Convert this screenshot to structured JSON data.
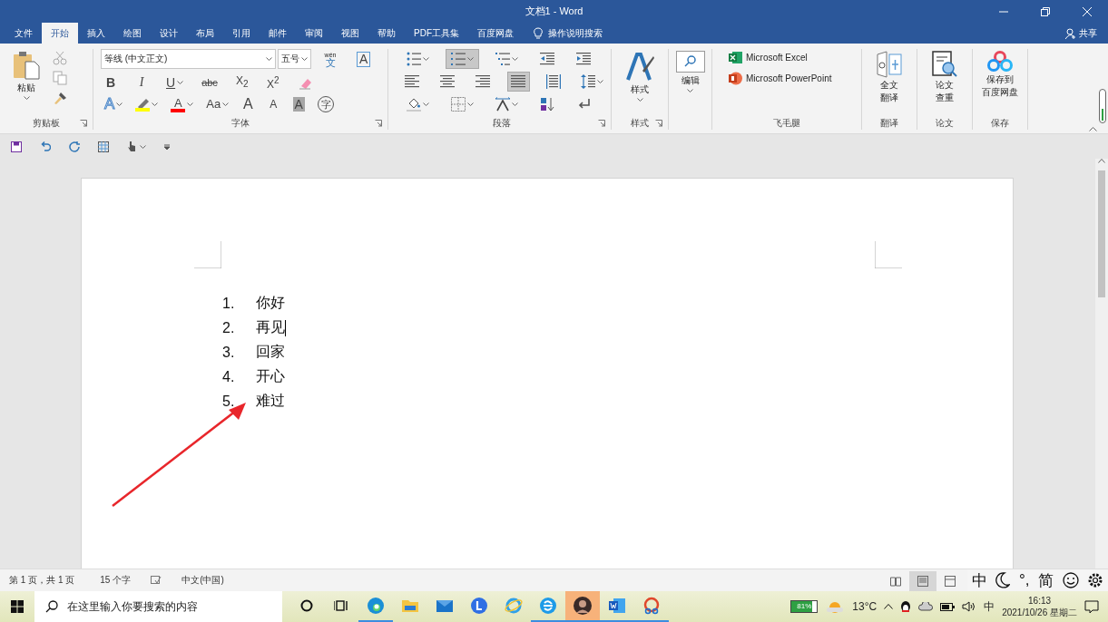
{
  "window": {
    "title": "文档1  -  Word"
  },
  "tabs": [
    {
      "label": "文件",
      "selected": false
    },
    {
      "label": "开始",
      "selected": true
    },
    {
      "label": "插入",
      "selected": false
    },
    {
      "label": "绘图",
      "selected": false
    },
    {
      "label": "设计",
      "selected": false
    },
    {
      "label": "布局",
      "selected": false
    },
    {
      "label": "引用",
      "selected": false
    },
    {
      "label": "邮件",
      "selected": false
    },
    {
      "label": "审阅",
      "selected": false
    },
    {
      "label": "视图",
      "selected": false
    },
    {
      "label": "帮助",
      "selected": false
    },
    {
      "label": "PDF工具集",
      "selected": false
    },
    {
      "label": "百度网盘",
      "selected": false
    }
  ],
  "tell_me": "操作说明搜索",
  "share": "共享",
  "clipboard": {
    "paste": "粘贴",
    "group": "剪贴板"
  },
  "font": {
    "name": "等线 (中文正文)",
    "size": "五号",
    "group": "字体",
    "phonetic": {
      "ruby": "wén",
      "label": "文"
    },
    "border": "A",
    "row1": [
      {
        "kind": "bold",
        "label": "B"
      },
      {
        "kind": "italic",
        "label": "I"
      },
      {
        "kind": "underline",
        "label": "U"
      },
      {
        "kind": "strike",
        "label": "abc"
      },
      {
        "kind": "sub",
        "label": "X$_{2}$"
      },
      {
        "kind": "sup",
        "label": "X$^{2}$"
      },
      {
        "kind": "clear"
      }
    ],
    "row2": [
      {
        "kind": "effects",
        "label": "A"
      },
      {
        "kind": "highlight",
        "color": "#ffff00"
      },
      {
        "kind": "fontcolor",
        "label": "A",
        "color": "#ff0000"
      },
      {
        "kind": "case",
        "label": "Aa"
      },
      {
        "kind": "grow",
        "label": "A"
      },
      {
        "kind": "shrink",
        "label": "A"
      },
      {
        "kind": "shade",
        "label": "A"
      },
      {
        "kind": "enclose",
        "label": "字"
      }
    ]
  },
  "paragraph": {
    "group": "段落",
    "rows": [
      [
        {
          "kind": "bullets",
          "selected": false
        },
        {
          "kind": "numbering",
          "selected": true
        },
        {
          "kind": "multilevel",
          "selected": false
        },
        {
          "kind": "outdent",
          "selected": false
        },
        {
          "kind": "indent",
          "selected": false
        }
      ],
      [
        {
          "kind": "left",
          "selected": false
        },
        {
          "kind": "center",
          "selected": false
        },
        {
          "kind": "right",
          "selected": false
        },
        {
          "kind": "justify",
          "selected": true
        },
        {
          "kind": "distributed",
          "selected": false
        },
        {
          "kind": "spacing",
          "selected": false
        }
      ],
      [
        {
          "kind": "shading",
          "selected": false
        },
        {
          "kind": "borders",
          "selected": false
        },
        {
          "kind": "asian",
          "selected": false
        },
        {
          "kind": "sort",
          "selected": false
        },
        {
          "kind": "marks",
          "selected": false
        }
      ]
    ]
  },
  "styles": {
    "label": "样式",
    "group": "样式"
  },
  "editing": {
    "label": "编辑"
  },
  "feimaotui": {
    "group": "飞毛腿",
    "items": [
      {
        "kind": "excel",
        "label": "Microsoft Excel"
      },
      {
        "kind": "powerpoint",
        "label": "Microsoft PowerPoint"
      }
    ]
  },
  "addins": [
    {
      "kind": "translate",
      "lines": [
        "全文",
        "翻译"
      ],
      "group": "翻译"
    },
    {
      "kind": "paper",
      "lines": [
        "论文",
        "查重"
      ],
      "group": "论文"
    },
    {
      "kind": "baidu",
      "lines": [
        "保存到",
        "百度网盘"
      ],
      "group": "保存"
    }
  ],
  "document": {
    "items": [
      {
        "number": "1.",
        "text": "你好",
        "cursor": false
      },
      {
        "number": "2.",
        "text": "再见",
        "cursor": true
      },
      {
        "number": "3.",
        "text": "回家",
        "cursor": false
      },
      {
        "number": "4.",
        "text": "开心",
        "cursor": false
      },
      {
        "number": "5.",
        "text": "难过",
        "cursor": false
      }
    ]
  },
  "status": {
    "page": "第 1 页，共 1 页",
    "words": "15 个字",
    "language": "中文(中国)",
    "views": [
      {
        "kind": "read",
        "selected": false
      },
      {
        "kind": "print",
        "selected": true
      },
      {
        "kind": "web",
        "selected": false
      }
    ]
  },
  "ime": [
    {
      "kind": "text",
      "label": "中"
    },
    {
      "kind": "moon"
    },
    {
      "kind": "text",
      "label": "°,"
    },
    {
      "kind": "text",
      "label": "简"
    },
    {
      "kind": "smile"
    },
    {
      "kind": "gear"
    }
  ],
  "taskbar": {
    "search": {
      "placeholder": "在这里输入你要搜索的内容"
    },
    "apps": [
      {
        "kind": "cortana",
        "running": false,
        "selected": false
      },
      {
        "kind": "taskview",
        "running": false,
        "selected": false
      },
      {
        "kind": "edge",
        "running": true,
        "selected": false
      },
      {
        "kind": "explorer",
        "running": false,
        "selected": false
      },
      {
        "kind": "mail",
        "running": false,
        "selected": false
      },
      {
        "kind": "lapp",
        "running": false,
        "selected": false
      },
      {
        "kind": "ie",
        "running": false,
        "selected": false
      },
      {
        "kind": "browser",
        "running": true,
        "selected": false
      },
      {
        "kind": "avatar",
        "running": true,
        "selected": true
      },
      {
        "kind": "word",
        "running": true,
        "selected": false
      },
      {
        "kind": "snip",
        "running": true,
        "selected": false
      }
    ],
    "battery": {
      "label": "81%",
      "level": 0.81
    },
    "weather": "13°C",
    "input": "中",
    "time": "16:13",
    "date": "2021/10/26 星期二"
  }
}
